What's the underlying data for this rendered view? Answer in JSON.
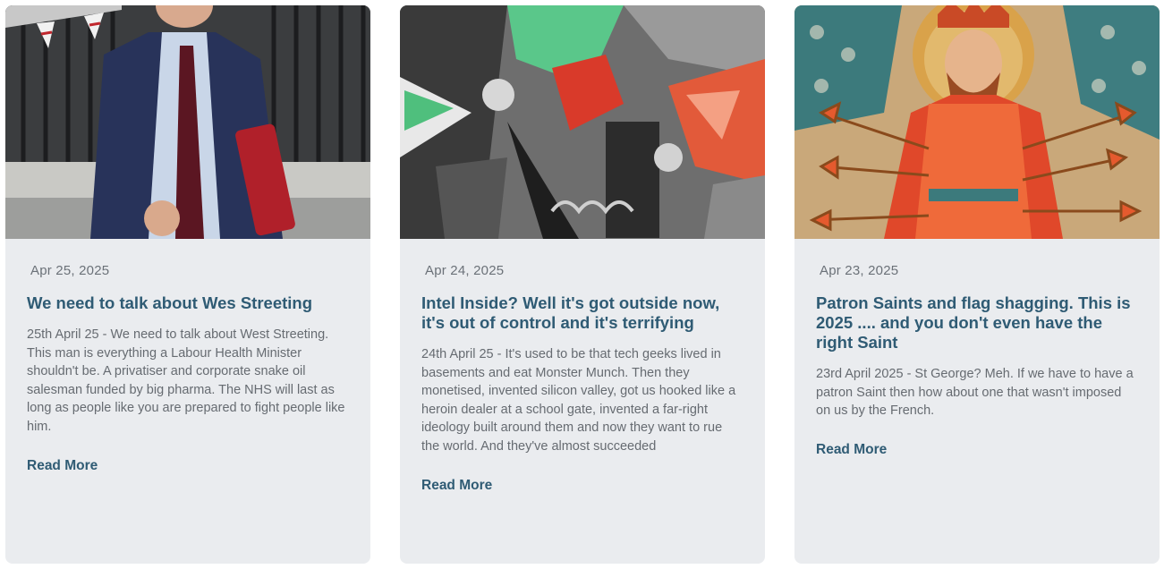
{
  "posts": [
    {
      "date": "Apr 25, 2025",
      "title": "We need to talk about Wes Streeting",
      "excerpt": "25th April 25 - We need to talk about West Streeting. This man is everything a Labour Health Minister shouldn't be. A privatiser and corporate snake oil salesman funded by big pharma. The NHS will last as long as people like you are prepared to fight people like him.",
      "read_more": "Read More"
    },
    {
      "date": "Apr 24, 2025",
      "title": "Intel Inside? Well it's got outside now, it's out of control and it's terrifying",
      "excerpt": "24th April 25 - It's used to be that tech geeks lived in basements and eat Monster Munch. Then they monetised, invented silicon valley, got us hooked like a heroin dealer at a school gate, invented a far-right ideology built around them and now they want to rue the world. And they've almost succeeded",
      "read_more": "Read More"
    },
    {
      "date": "Apr 23, 2025",
      "title": "Patron Saints and flag shagging. This is 2025 .... and you don't even have the right Saint",
      "excerpt": "23rd April 2025 - St George? Meh. If we have to have a patron Saint then how about one that wasn't imposed on us by the French.",
      "read_more": "Read More"
    }
  ]
}
